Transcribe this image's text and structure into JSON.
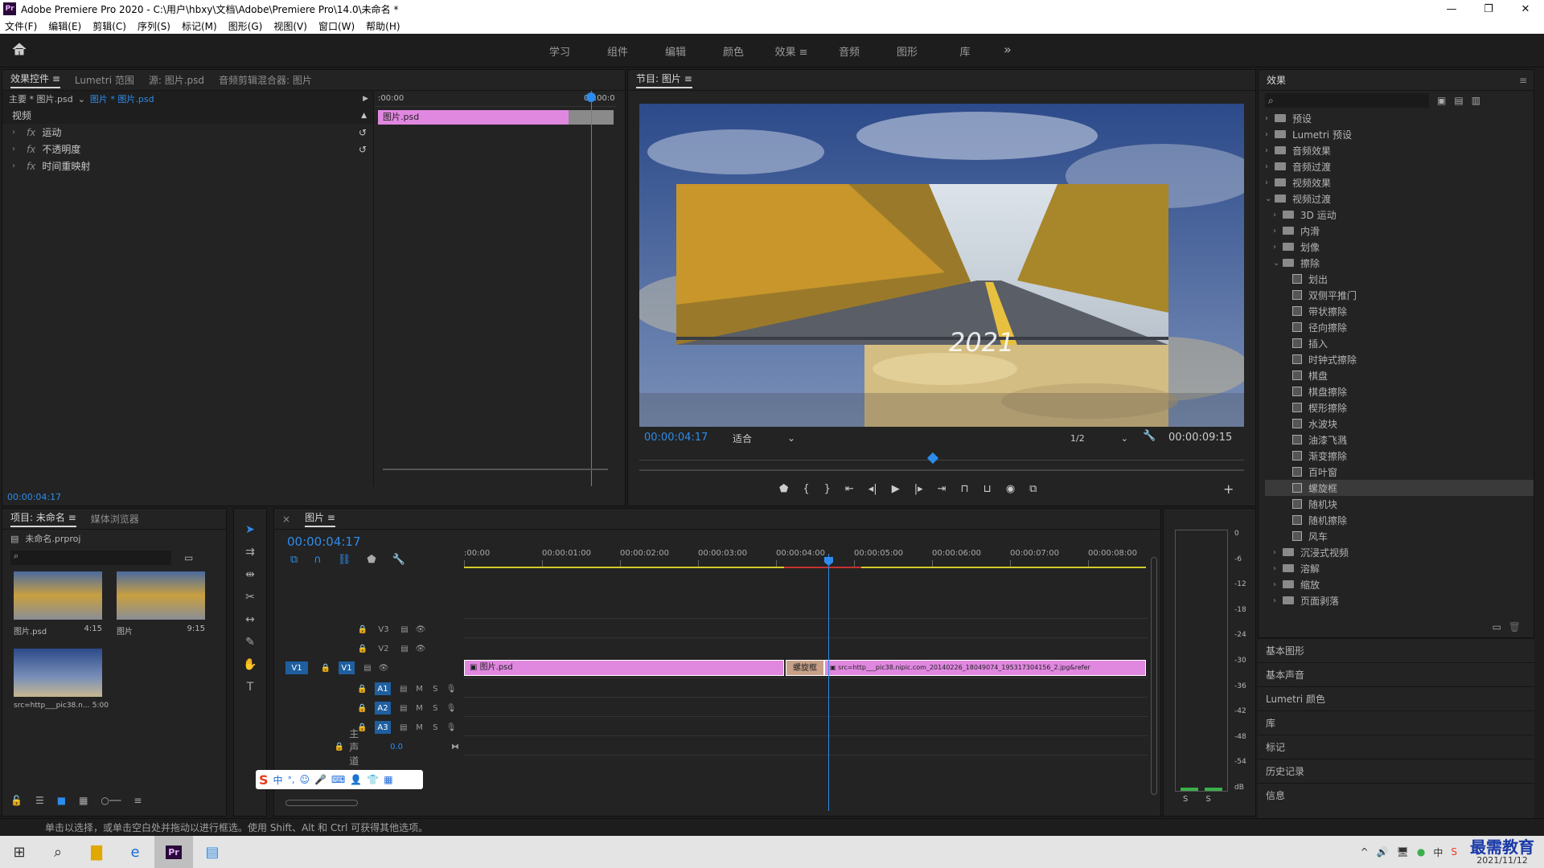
{
  "window": {
    "title": "Adobe Premiere Pro 2020 - C:\\用户\\hbxy\\文档\\Adobe\\Premiere Pro\\14.0\\未命名 *",
    "logo": "Pr",
    "min": "—",
    "max": "❐",
    "close": "✕"
  },
  "menu": [
    "文件(F)",
    "编辑(E)",
    "剪辑(C)",
    "序列(S)",
    "标记(M)",
    "图形(G)",
    "视图(V)",
    "窗口(W)",
    "帮助(H)"
  ],
  "workspaces": {
    "tabs": [
      "学习",
      "组件",
      "编辑",
      "颜色",
      "效果",
      "音频",
      "图形",
      "库"
    ],
    "active": "效果",
    "more": "»",
    "active_menu": "≡"
  },
  "effect_controls": {
    "tabs": [
      "效果控件",
      "Lumetri 范围",
      "源: 图片.psd",
      "音频剪辑混合器: 图片"
    ],
    "menu": "≡",
    "master": "主要 * 图片.psd",
    "clip": "图片 * 图片.psd",
    "ruler_start": ":00:00",
    "ruler_end": "00:00:0",
    "clip_label": "图片.psd",
    "section": "视频",
    "rows": [
      {
        "fx": "fx",
        "name": "运动"
      },
      {
        "fx": "fx",
        "name": "不透明度"
      },
      {
        "fx": "fx",
        "name": "时间重映射"
      }
    ],
    "timecode": "00:00:04:17"
  },
  "program": {
    "title": "节目: 图片",
    "menu": "≡",
    "timecode": "00:00:04:17",
    "fit": "适合",
    "quality": "1/2",
    "duration": "00:00:09:15",
    "overlay_text": "2021"
  },
  "effects": {
    "title": "效果",
    "menu": "≡",
    "search_placeholder": "",
    "top_items": [
      "预设",
      "Lumetri 预设",
      "音频效果",
      "音频过渡",
      "视频效果",
      "视频过渡"
    ],
    "sub_folders": [
      "3D 运动",
      "内滑",
      "划像",
      "擦除"
    ],
    "wipes": [
      "划出",
      "双侧平推门",
      "带状擦除",
      "径向擦除",
      "插入",
      "时钟式擦除",
      "棋盘",
      "棋盘擦除",
      "楔形擦除",
      "水波块",
      "油漆飞溅",
      "渐变擦除",
      "百叶窗",
      "螺旋框",
      "随机块",
      "随机擦除",
      "风车"
    ],
    "selected": "螺旋框",
    "after_folders": [
      "沉浸式视频",
      "溶解",
      "缩放",
      "页面剥落"
    ],
    "collapsed_panels": [
      "基本图形",
      "基本声音",
      "Lumetri 颜色",
      "库",
      "标记",
      "历史记录",
      "信息"
    ]
  },
  "project": {
    "tabs": [
      "项目: 未命名",
      "媒体浏览器"
    ],
    "menu": "≡",
    "file": "未命名.prproj",
    "items": [
      {
        "name": "图片.psd",
        "dur": "4:15"
      },
      {
        "name": "图片",
        "dur": "9:15"
      },
      {
        "name": "src=http___pic38.n...",
        "dur": "5:00"
      }
    ]
  },
  "timeline": {
    "title": "图片",
    "menu": "≡",
    "close": "×",
    "timecode": "00:00:04:17",
    "ruler": [
      ":00:00",
      "00:00:01:00",
      "00:00:02:00",
      "00:00:03:00",
      "00:00:04:00",
      "00:00:05:00",
      "00:00:06:00",
      "00:00:07:00",
      "00:00:08:00"
    ],
    "tracks_video": [
      "V3",
      "V2",
      "V1"
    ],
    "tracks_audio": [
      "A1",
      "A2",
      "A3"
    ],
    "v1_source": "V1",
    "master": "主声道",
    "master_val": "0.0",
    "clip1": "图片.psd",
    "transition": "螺旋框",
    "clip2": "src=http___pic38.nipic.com_20140226_18049074_195317304156_2.jpg&refer",
    "m": "M",
    "s": "S"
  },
  "meter": {
    "scale": [
      "0",
      "-6",
      "-12",
      "-18",
      "-24",
      "-30",
      "-36",
      "-42",
      "-48",
      "-54",
      "dB"
    ],
    "solo": [
      "S",
      "S"
    ]
  },
  "ime": {
    "logo": "S",
    "mode": "中",
    "punct": "°,",
    "icons": [
      "☺",
      "🎤",
      "⌨",
      "👤",
      "👕",
      "▦"
    ]
  },
  "status": "单击以选择，或单击空白处并拖动以进行框选。使用 Shift、Alt 和 Ctrl 可获得其他选项。",
  "taskbar": {
    "date": "2021/11/12",
    "watermark": "最需教育",
    "tray": [
      "^",
      "🔊",
      "🖥",
      "●",
      "中",
      "S"
    ]
  }
}
